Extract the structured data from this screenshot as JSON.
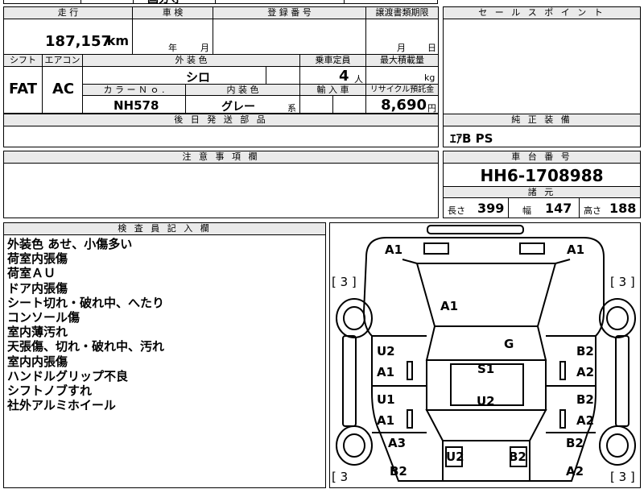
{
  "top_strip": {
    "partial_text": "国分寺"
  },
  "mileage": {
    "label": "走 行",
    "value": "187,157",
    "unit": "km"
  },
  "inspection": {
    "label": "車 検",
    "year_unit": "年",
    "month_unit": "月"
  },
  "registration": {
    "label": "登 録 番 号"
  },
  "transfer_deadline": {
    "label": "譲渡書類期限",
    "month_unit": "月",
    "day_unit": "日"
  },
  "shift": {
    "label": "シフト",
    "value": "FAT"
  },
  "aircon": {
    "label": "エアコン",
    "value": "AC"
  },
  "exterior_color": {
    "label": "外 装 色",
    "value": "シロ"
  },
  "capacity": {
    "label": "乗車定員",
    "value": "4",
    "unit": "人"
  },
  "max_load": {
    "label": "最大積載量",
    "unit": "kg"
  },
  "color_no": {
    "label": "カ ラ ー Ｎ ｏ .",
    "value": "NH578"
  },
  "interior_color": {
    "label": "内 装 色",
    "value": "グレー",
    "suffix": "系"
  },
  "import": {
    "label": "輸 入 車"
  },
  "recycle": {
    "label": "リサイクル預託金",
    "value": "8,690",
    "unit": "円"
  },
  "later_parts": {
    "label": "後 日 発 送 部 品"
  },
  "sales_point": {
    "label": "セ ー ル ス ポ イ ン ト"
  },
  "genuine_equipment": {
    "label": "純 正 装 備",
    "value": "ｴｱB PS"
  },
  "notes": {
    "label": "注 意 事 項 欄"
  },
  "chassis": {
    "label": "車 台 番 号",
    "value": "HH6-1708988"
  },
  "specs": {
    "label": "諸 元",
    "length_label": "長さ",
    "length_value": "399",
    "width_label": "幅",
    "width_value": "147",
    "height_label": "高さ",
    "height_value": "188"
  },
  "inspector": {
    "label": "検 査 員 記 入 欄",
    "remarks": [
      "外装色 あせ、小傷多い",
      "荷室内張傷",
      "荷室ＡＵ",
      "ドア内張傷",
      "シート切れ・破れ中、へたり",
      "コンソール傷",
      "室内薄汚れ",
      "天張傷、切れ・破れ中、汚れ",
      "室内内張傷",
      "ハンドルグリップ不良",
      "シフトノブすれ",
      "社外アルミホイール"
    ]
  },
  "diagram": {
    "tire_tread_tl": "[ 3 ]",
    "tire_tread_tr": "[ 3 ]",
    "tire_tread_bl": "[ 3",
    "tire_tread_br": "[ 3 ]",
    "front_left": "A1",
    "front_right": "A1",
    "hood": "A1",
    "windshield": "G",
    "fl_door_top": "U2",
    "fl_door_bottom": "A1",
    "fr_door_top": "B2",
    "fr_door_bottom": "A2",
    "roof_front": "S1",
    "roof_rear": "U2",
    "rl_door_top": "U1",
    "rl_door_bottom": "A1",
    "rr_door_top": "B2",
    "rr_door_bottom": "A2",
    "rear_left_fender": "A3",
    "rear_right_fender": "B2",
    "rear_left_corner": "B2",
    "rear_right_corner": "A2",
    "rear_gate_left": "U2",
    "rear_gate_right": "B2"
  }
}
